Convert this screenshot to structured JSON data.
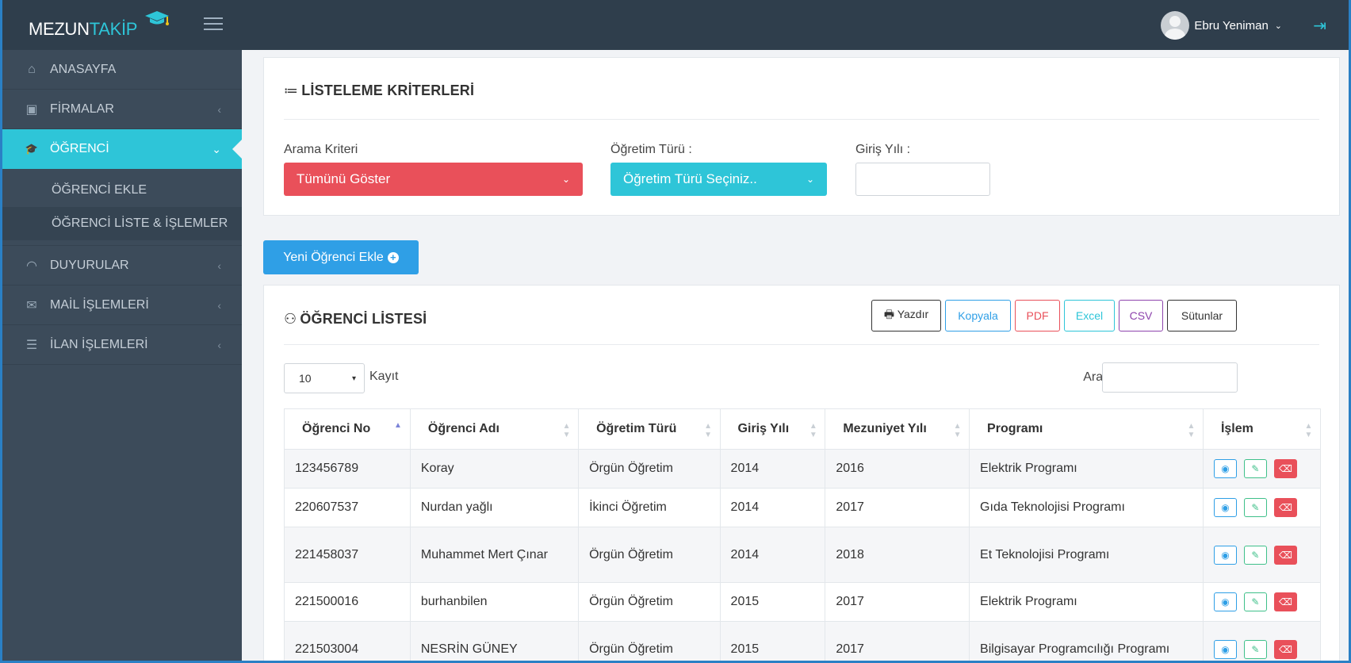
{
  "brand": {
    "part1": "MEZUN",
    "part2": "TAKİP"
  },
  "topbar": {
    "user_name": "Ebru Yeniman",
    "user_chevron": "⌄",
    "logout_glyph": "⇥"
  },
  "sidebar": {
    "items": [
      {
        "label": "ANASAYFA",
        "icon": "home-icon",
        "glyph": "⌂"
      },
      {
        "label": "FİRMALAR",
        "icon": "briefcase-icon",
        "glyph": "▣"
      },
      {
        "label": "ÖĞRENCİ",
        "icon": "graduation-cap-icon",
        "glyph": "🎓"
      },
      {
        "label": "DUYURULAR",
        "icon": "rss-icon",
        "glyph": "◠"
      },
      {
        "label": "MAİL İŞLEMLERİ",
        "icon": "envelope-icon",
        "glyph": "✉"
      },
      {
        "label": "İLAN İŞLEMLERİ",
        "icon": "list-icon",
        "glyph": "☰"
      }
    ],
    "sub_items": [
      {
        "label": "ÖĞRENCİ EKLE"
      },
      {
        "label": "ÖĞRENCİ LİSTE & İŞLEMLER"
      }
    ],
    "arrow_collapsed": "‹",
    "arrow_expanded": "⌄"
  },
  "criteria": {
    "title": "LİSTELEME KRİTERLERİ",
    "title_icon": "≔",
    "search_label": "Arama Kriteri",
    "search_value": "Tümünü Göster",
    "type_label": "Öğretim Türü :",
    "type_value": "Öğretim Türü Seçiniz..",
    "year_label": "Giriş Yılı :",
    "year_value": "",
    "dropdown_glyph": "⌄"
  },
  "new_button": {
    "label": "Yeni Öğrenci Ekle",
    "plus": "+"
  },
  "list": {
    "title": "ÖĞRENCİ LİSTESİ",
    "title_icon": "⚇",
    "toolbar": {
      "print": "🖶 Yazdır",
      "copy": "Kopyala",
      "pdf": "PDF",
      "excel": "Excel",
      "csv": "CSV",
      "columns": "Sütunlar"
    },
    "colors": {
      "print": "#333333",
      "copy": "#2f9fe6",
      "pdf": "#e9505a",
      "excel": "#2ec5d8",
      "csv": "#8e44ad",
      "columns": "#333333"
    },
    "page_length": "10",
    "page_length_glyph": "▾",
    "page_length_label": "Kayıt",
    "search_label": "Ara :",
    "search_value": "",
    "columns": [
      "Öğrenci No",
      "Öğrenci Adı",
      "Öğretim Türü",
      "Giriş Yılı",
      "Mezuniyet Yılı",
      "Programı",
      "İşlem"
    ],
    "sort_glyph": "▲▼",
    "sort_asc_glyph": "▲",
    "rows": [
      {
        "no": "123456789",
        "name": "Koray",
        "type": "Örgün Öğretim",
        "entry": "2014",
        "grad": "2016",
        "program": "Elektrik Programı"
      },
      {
        "no": "220607537",
        "name": "Nurdan yağlı",
        "type": "İkinci Öğretim",
        "entry": "2014",
        "grad": "2017",
        "program": "Gıda Teknolojisi Programı"
      },
      {
        "no": "221458037",
        "name": "Muhammet Mert Çınar",
        "type": "Örgün Öğretim",
        "entry": "2014",
        "grad": "2018",
        "program": "Et Teknolojisi Programı"
      },
      {
        "no": "221500016",
        "name": "burhanbilen",
        "type": "Örgün Öğretim",
        "entry": "2015",
        "grad": "2017",
        "program": "Elektrik Programı"
      },
      {
        "no": "221503004",
        "name": "NESRİN GÜNEY",
        "type": "Örgün Öğretim",
        "entry": "2015",
        "grad": "2017",
        "program": "Bilgisayar Programcılığı Programı"
      }
    ],
    "action_glyphs": {
      "view": "◉",
      "edit": "✎",
      "delete": "⌫"
    }
  }
}
